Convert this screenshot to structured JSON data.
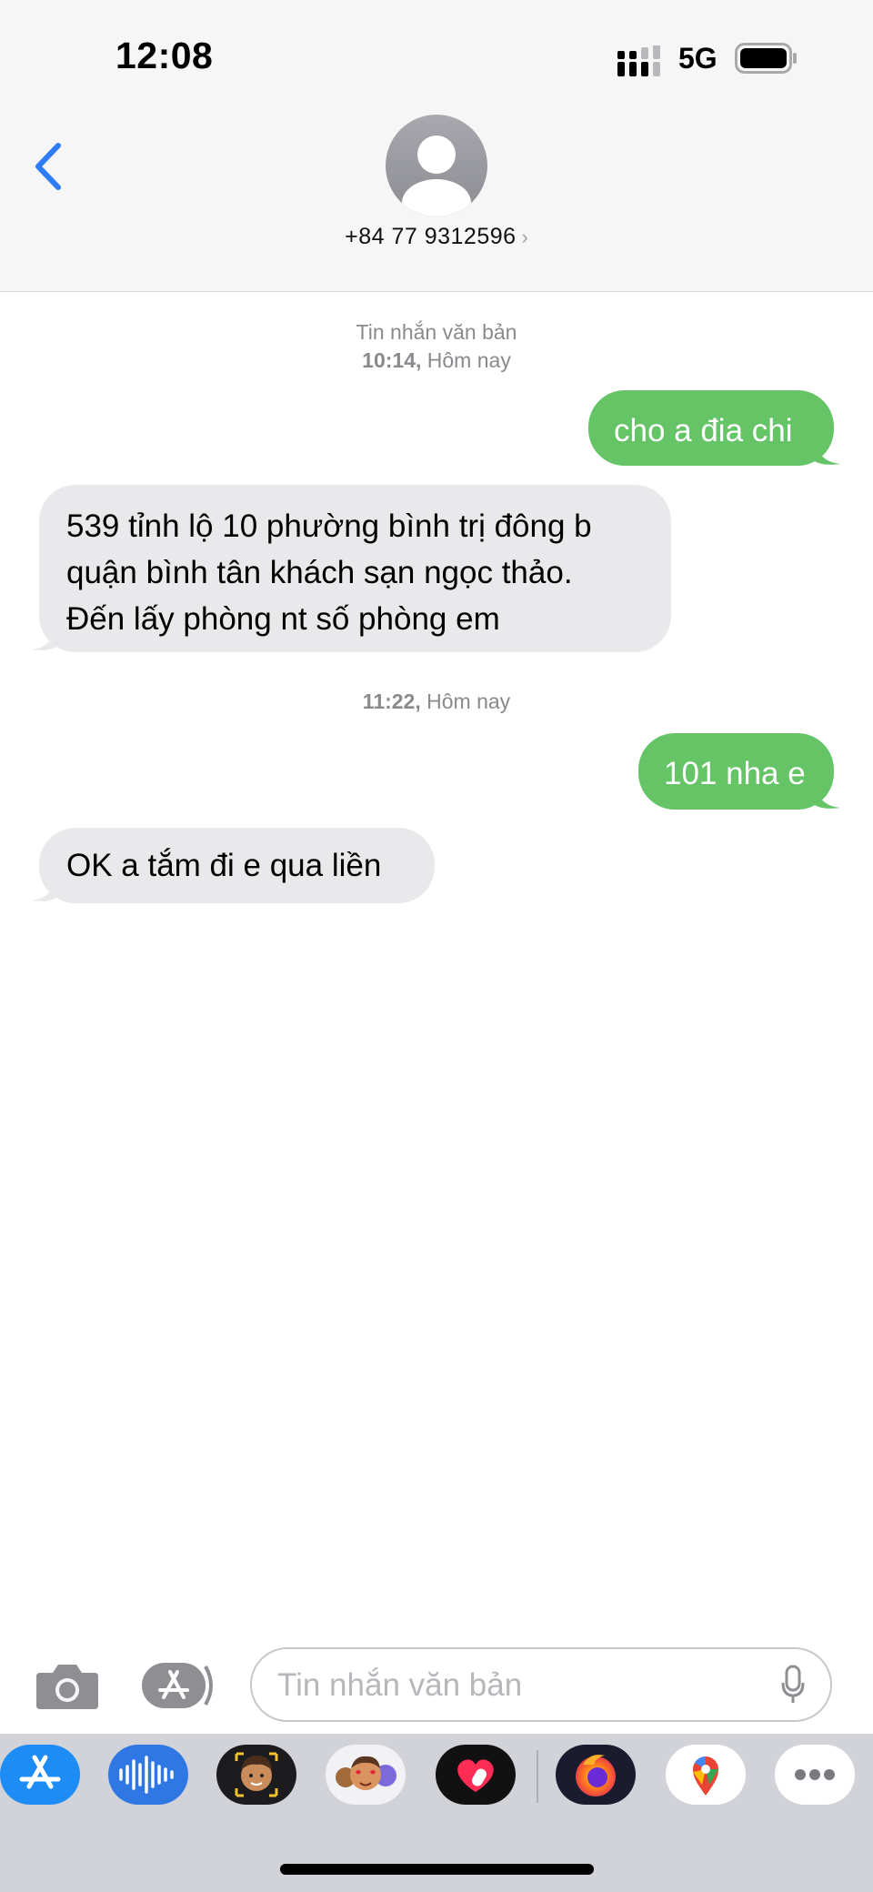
{
  "status_bar": {
    "time": "12:08",
    "network": "5G"
  },
  "contact": {
    "phone": "+84 77 9312596",
    "chevron": "›"
  },
  "messages": {
    "meta1": {
      "line1": "Tin nhắn văn bản",
      "line2_time": "10:14,",
      "line2_day": "Hôm nay"
    },
    "m1": "cho a đia chi",
    "m2": {
      "line1": "539 tỉnh lộ 10 phường bình trị đông b",
      "line2": "quận bình tân khách sạn ngọc thảo.",
      "line3": "Đến lấy phòng nt số phòng em"
    },
    "meta2": {
      "time": "11:22,",
      "day": "Hôm nay"
    },
    "m3": "101 nha e",
    "m4": "OK a tắm đi e qua liền"
  },
  "composer": {
    "placeholder": "Tin nhắn văn bản"
  },
  "app_drawer": [
    {
      "name": "app-store-icon"
    },
    {
      "name": "audio-message-icon"
    },
    {
      "name": "memoji-icon"
    },
    {
      "name": "memoji-stickers-icon"
    },
    {
      "name": "digital-touch-icon"
    },
    {
      "name": "firefox-icon"
    },
    {
      "name": "google-maps-icon"
    },
    {
      "name": "more-apps-icon"
    }
  ],
  "colors": {
    "outgoing": "#65c466",
    "incoming": "#e9e9eb",
    "accent": "#2f7cf6",
    "meta_text": "#8a8a8e"
  }
}
